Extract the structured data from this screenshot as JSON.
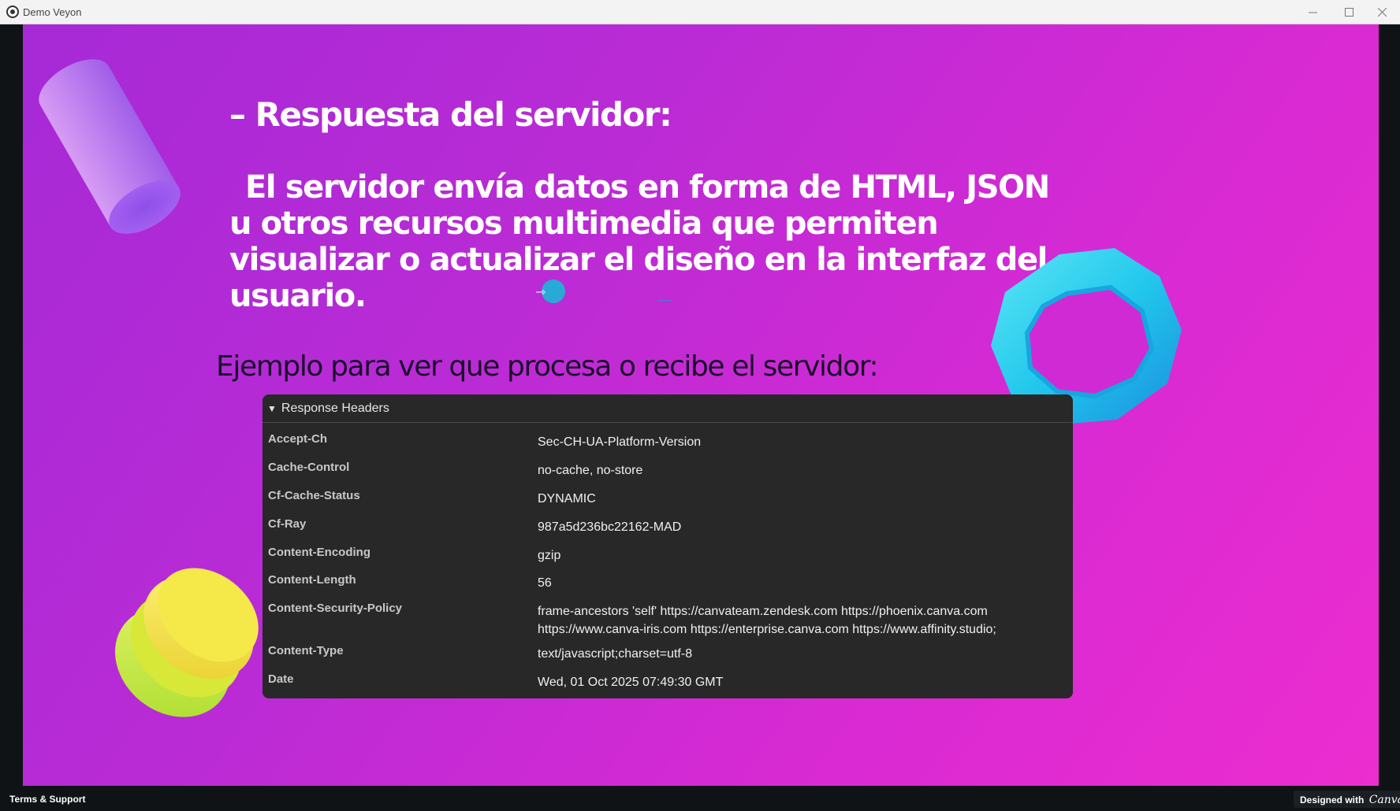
{
  "window": {
    "title": "Demo Veyon",
    "minimize_icon": "minimize-icon",
    "maximize_icon": "maximize-icon",
    "close_icon": "close-icon"
  },
  "slide": {
    "heading": "– Respuesta del servidor:",
    "paragraph": "El servidor envía datos en forma de HTML, JSON u otros recursos multimedia que permiten visualizar o actualizar el diseño en la interfaz del usuario.",
    "example": "Ejemplo para ver que procesa o recibe el servidor:"
  },
  "panel": {
    "title": "Response Headers",
    "caret_icon": "caret-down-icon",
    "rows": [
      {
        "name": "Accept-Ch",
        "value": "Sec-CH-UA-Platform-Version"
      },
      {
        "name": "Cache-Control",
        "value": "no-cache, no-store"
      },
      {
        "name": "Cf-Cache-Status",
        "value": "DYNAMIC"
      },
      {
        "name": "Cf-Ray",
        "value": "987a5d236bc22162-MAD"
      },
      {
        "name": "Content-Encoding",
        "value": "gzip"
      },
      {
        "name": "Content-Length",
        "value": "56"
      },
      {
        "name": "Content-Security-Policy",
        "value": "frame-ancestors 'self' https://canvateam.zendesk.com https://phoenix.canva.com https://www.canva-iris.com https://enterprise.canva.com https://www.affinity.studio;"
      },
      {
        "name": "Content-Type",
        "value": "text/javascript;charset=utf-8"
      },
      {
        "name": "Date",
        "value": "Wed, 01 Oct 2025 07:49:30 GMT"
      }
    ]
  },
  "footer": {
    "terms": "Terms & Support",
    "designed_with": "Designed with",
    "canva": "Canva"
  },
  "colors": {
    "slide_start": "#a62ad6",
    "slide_end": "#ec2dcf",
    "panel_bg": "#282828",
    "octagon": "#22c8ec",
    "macaron_yellow": "#f2e64a",
    "macaron_green": "#c9ea3a"
  }
}
